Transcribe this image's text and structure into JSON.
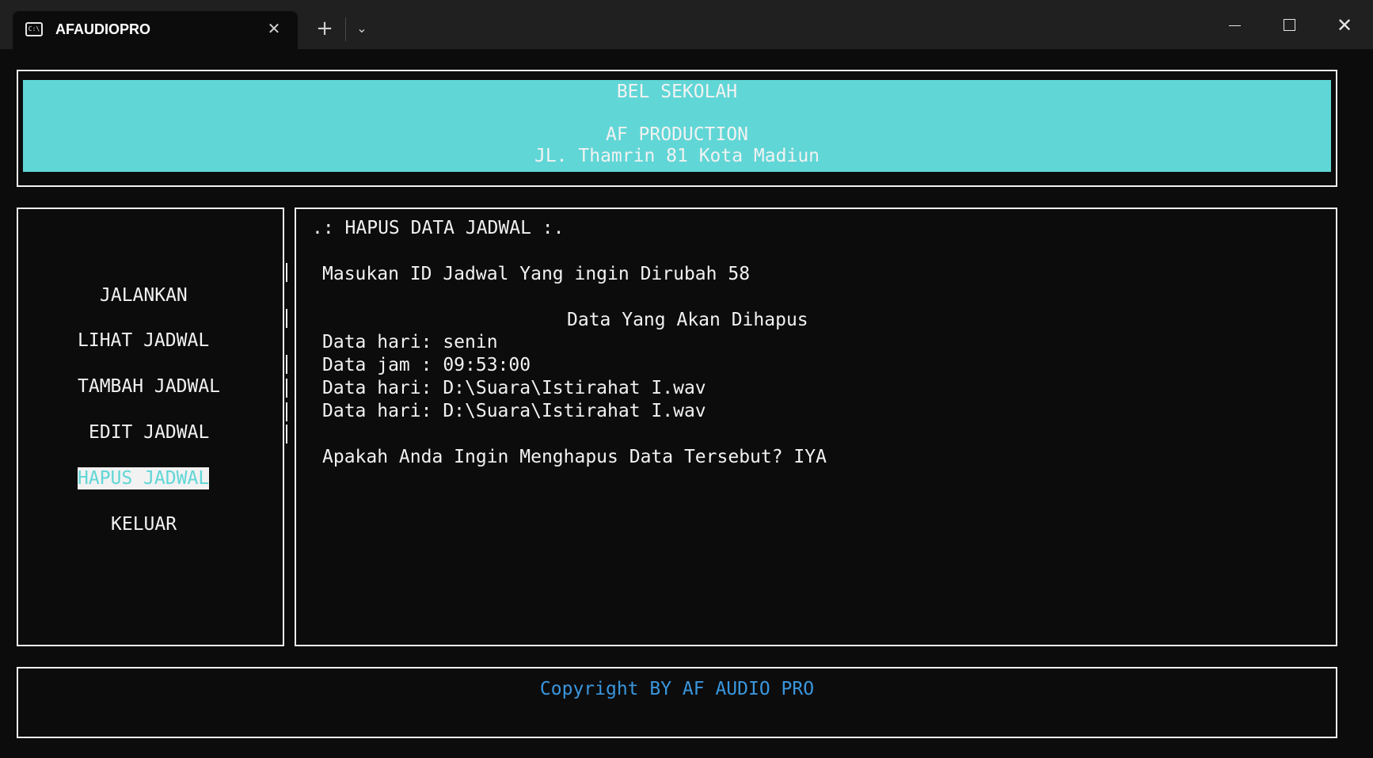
{
  "window": {
    "tab_title": "AFAUDIOPRO",
    "tab_icon": "terminal-icon",
    "tab_icon_glyph": "C:\\",
    "close_tab_glyph": "✕",
    "new_tab_glyph": "+",
    "dropdown_glyph": "⌄",
    "close_glyph": "✕"
  },
  "header": {
    "title": "BEL SEKOLAH",
    "company": "AF PRODUCTION",
    "address": "JL. Thamrin 81 Kota Madiun"
  },
  "menu": {
    "items": [
      {
        "label": "JALANKAN",
        "selected": false
      },
      {
        "label": "LIHAT JADWAL",
        "selected": false
      },
      {
        "label": "TAMBAH JADWAL",
        "selected": false
      },
      {
        "label": "EDIT JADWAL",
        "selected": false
      },
      {
        "label": "HAPUS JADWAL",
        "selected": true
      },
      {
        "label": "KELUAR",
        "selected": false
      }
    ]
  },
  "content": {
    "heading": ".: HAPUS DATA JADWAL :.",
    "prompt": "Masukan ID Jadwal Yang ingin Dirubah 58",
    "section_title": "Data Yang Akan Dihapus",
    "lines": [
      "Data hari: senin",
      "Data jam : 09:53:00",
      "Data hari: D:\\Suara\\Istirahat I.wav",
      "Data hari: D:\\Suara\\Istirahat I.wav"
    ],
    "confirm": "Apakah Anda Ingin Menghapus Data Tersebut? IYA"
  },
  "footer": {
    "copyright": "Copyright BY AF AUDIO PRO"
  },
  "colors": {
    "background": "#0c0c0c",
    "header_fill": "#61d6d6",
    "footer_text": "#3a96dd",
    "foreground": "#f2f2f2"
  }
}
